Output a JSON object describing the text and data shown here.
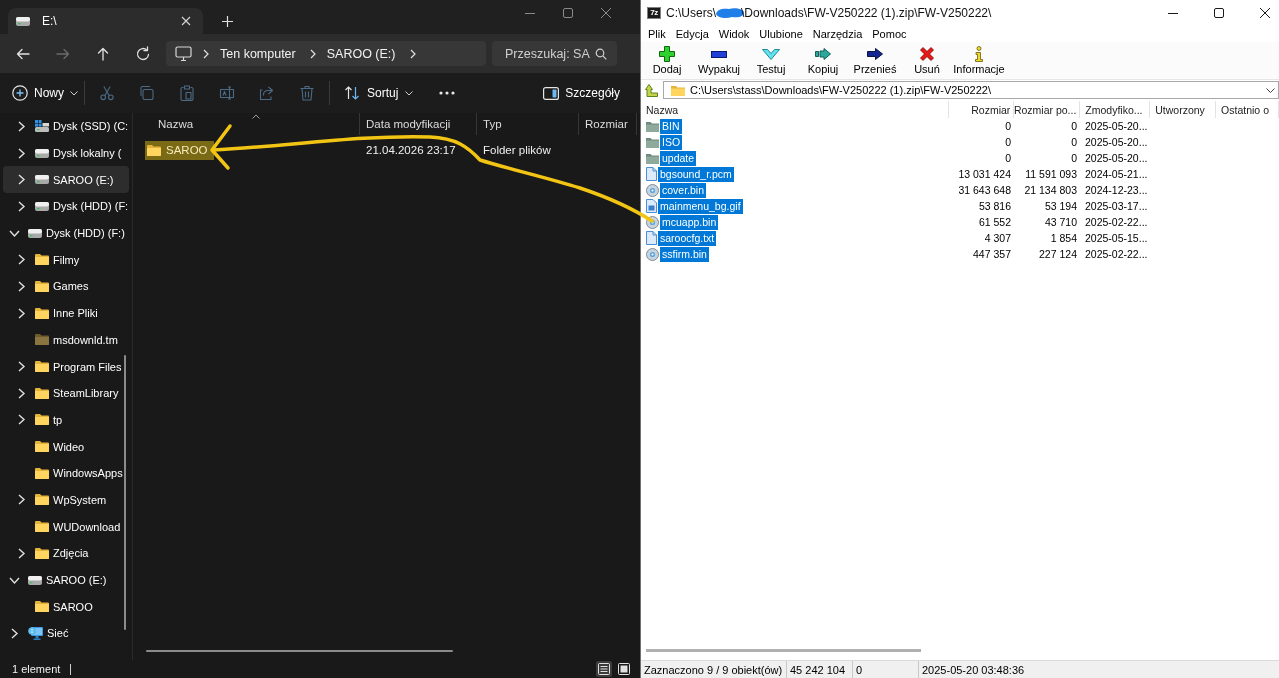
{
  "explorer": {
    "tab": {
      "title": "E:\\"
    },
    "nav": [
      {
        "kind": "back",
        "disabled": false
      },
      {
        "kind": "forward",
        "disabled": true
      },
      {
        "kind": "up",
        "disabled": false
      },
      {
        "kind": "refresh",
        "disabled": false
      }
    ],
    "breadcrumb": [
      "Ten komputer",
      "SAROO (E:)"
    ],
    "search": {
      "placeholder": "Przeszukaj: SA"
    },
    "toolbar": {
      "new_label": "Nowy",
      "actions": [
        {
          "kind": "cut",
          "disabled": true
        },
        {
          "kind": "copy",
          "disabled": true
        },
        {
          "kind": "paste",
          "disabled": true
        },
        {
          "kind": "rename",
          "disabled": true
        },
        {
          "kind": "share",
          "disabled": true
        },
        {
          "kind": "delete",
          "disabled": true
        }
      ],
      "sort_label": "Sortuj",
      "details_label": "Szczegóły"
    },
    "sidebar": {
      "top_children": [
        {
          "label": "Dysk (SSD) (C:",
          "kind": "ssd",
          "expandable": true,
          "expanded": false,
          "selected": false
        },
        {
          "label": "Dysk lokalny (",
          "kind": "drive",
          "expandable": true,
          "expanded": false,
          "selected": false
        },
        {
          "label": "SAROO (E:)",
          "kind": "drive",
          "expandable": true,
          "expanded": false,
          "selected": true
        },
        {
          "label": "Dysk (HDD) (F:",
          "kind": "drive",
          "expandable": true,
          "expanded": false,
          "selected": false
        }
      ],
      "items": [
        {
          "label": "Dysk (HDD) (F:)",
          "kind": "drive",
          "expandable": true,
          "expanded": true,
          "selected": false,
          "children": [
            {
              "label": "Filmy",
              "kind": "folder",
              "expandable": true,
              "expanded": false,
              "selected": false
            },
            {
              "label": "Games",
              "kind": "folder",
              "expandable": true,
              "expanded": false,
              "selected": false
            },
            {
              "label": "Inne Pliki",
              "kind": "folder",
              "expandable": true,
              "expanded": false,
              "selected": false
            },
            {
              "label": "msdownld.tm",
              "kind": "hidden_folder",
              "expandable": false,
              "expanded": false,
              "selected": false
            },
            {
              "label": "Program Files",
              "kind": "folder",
              "expandable": true,
              "expanded": false,
              "selected": false
            },
            {
              "label": "SteamLibrary",
              "kind": "folder",
              "expandable": true,
              "expanded": false,
              "selected": false
            },
            {
              "label": "tp",
              "kind": "folder",
              "expandable": true,
              "expanded": false,
              "selected": false
            },
            {
              "label": "Wideo",
              "kind": "folder",
              "expandable": false,
              "expanded": false,
              "selected": false
            },
            {
              "label": "WindowsApps",
              "kind": "folder",
              "expandable": false,
              "expanded": false,
              "selected": false
            },
            {
              "label": "WpSystem",
              "kind": "folder",
              "expandable": true,
              "expanded": false,
              "selected": false
            },
            {
              "label": "WUDownload",
              "kind": "folder",
              "expandable": false,
              "expanded": false,
              "selected": false
            },
            {
              "label": "Zdjęcia",
              "kind": "folder",
              "expandable": true,
              "expanded": false,
              "selected": false
            }
          ]
        },
        {
          "label": "SAROO (E:)",
          "kind": "drive",
          "expandable": true,
          "expanded": true,
          "selected": false,
          "children": [
            {
              "label": "SAROO",
              "kind": "folder",
              "expandable": false,
              "expanded": false,
              "selected": false
            }
          ]
        },
        {
          "label": "Sieć",
          "kind": "network",
          "expandable": true,
          "expanded": false,
          "selected": false
        }
      ]
    },
    "columns": [
      "Nazwa",
      "Data modyfikacji",
      "Typ",
      "Rozmiar"
    ],
    "rows": [
      {
        "name": "SAROO",
        "modified": "21.04.2026 23:17",
        "type": "Folder plików",
        "highlighted": true
      }
    ],
    "status": "1 element",
    "views": [
      {
        "kind": "details",
        "selected": true
      },
      {
        "kind": "tiles",
        "selected": false
      }
    ]
  },
  "sevenzip": {
    "logo": "7z",
    "title_parts": [
      "C:\\Users\\",
      "\\Downloads\\FW-V250222 (1).zip\\FW-V250222\\"
    ],
    "redacted": true,
    "menu": [
      "Plik",
      "Edycja",
      "Widok",
      "Ulubione",
      "Narzędzia",
      "Pomoc"
    ],
    "toolbar": [
      {
        "kind": "add",
        "label": "Dodaj"
      },
      {
        "kind": "extract",
        "label": "Wypakuj"
      },
      {
        "kind": "test",
        "label": "Testuj"
      },
      {
        "kind": "copy",
        "label": "Kopiuj"
      },
      {
        "kind": "move",
        "label": "Przenieś"
      },
      {
        "kind": "delete",
        "label": "Usuń"
      },
      {
        "kind": "info",
        "label": "Informacje"
      }
    ],
    "path": "C:\\Users\\stass\\Downloads\\FW-V250222 (1).zip\\FW-V250222\\",
    "columns": [
      "Nazwa",
      "Rozmiar",
      "Rozmiar po...",
      "Zmodyfiko...",
      "Utworzony",
      "Ostatnio o"
    ],
    "rows": [
      {
        "kind": "folder",
        "name": "BIN",
        "size": "0",
        "packed": "0",
        "modified": "2025-05-20...",
        "selected": true
      },
      {
        "kind": "folder",
        "name": "ISO",
        "size": "0",
        "packed": "0",
        "modified": "2025-05-20...",
        "selected": true
      },
      {
        "kind": "folder",
        "name": "update",
        "size": "0",
        "packed": "0",
        "modified": "2025-05-20...",
        "selected": true
      },
      {
        "kind": "file",
        "name": "bgsound_r.pcm",
        "size": "13 031 424",
        "packed": "11 591 093",
        "modified": "2024-05-21...",
        "selected": true
      },
      {
        "kind": "disc",
        "name": "cover.bin",
        "size": "31 643 648",
        "packed": "21 134 803",
        "modified": "2024-12-23...",
        "selected": true
      },
      {
        "kind": "image",
        "name": "mainmenu_bg.gif",
        "size": "53 816",
        "packed": "53 194",
        "modified": "2025-03-17...",
        "selected": true
      },
      {
        "kind": "disc",
        "name": "mcuapp.bin",
        "size": "61 552",
        "packed": "43 710",
        "modified": "2025-02-22...",
        "selected": true
      },
      {
        "kind": "file",
        "name": "saroocfg.txt",
        "size": "4 307",
        "packed": "1 854",
        "modified": "2025-05-15...",
        "selected": true
      },
      {
        "kind": "disc",
        "name": "ssfirm.bin",
        "size": "447 357",
        "packed": "227 124",
        "modified": "2025-02-22...",
        "selected": true
      }
    ],
    "status": [
      "Zaznaczono 9 / 9 obiekt(ów)",
      "45 242 104",
      "0",
      "2025-05-20 03:48:36"
    ]
  },
  "annotation": {
    "kind": "arrow"
  }
}
